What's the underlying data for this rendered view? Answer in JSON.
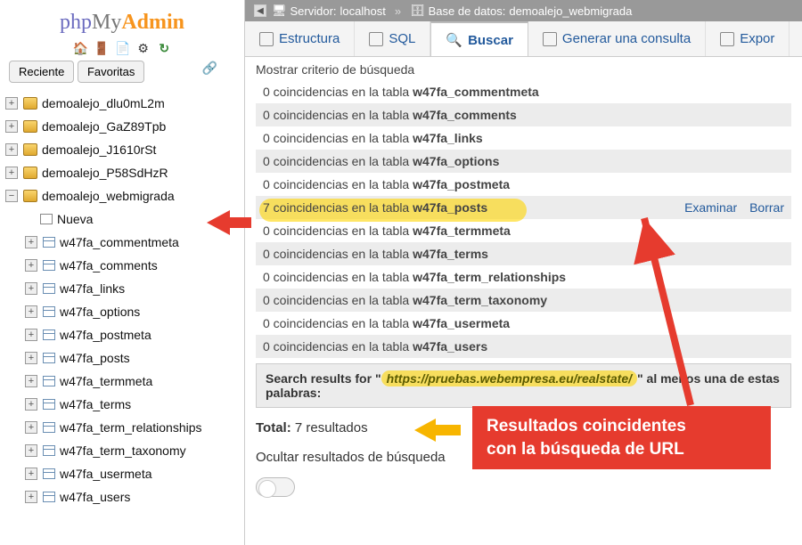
{
  "logo": {
    "php": "php",
    "my": "My",
    "admin": "Admin"
  },
  "sidebar": {
    "recent": "Reciente",
    "fav": "Favoritas",
    "dbs": [
      "demoalejo_dlu0mL2m",
      "demoalejo_GaZ89Tpb",
      "demoalejo_J1610rSt",
      "demoalejo_P58SdHzR",
      "demoalejo_webmigrada"
    ],
    "new_label": "Nueva",
    "tables": [
      "w47fa_commentmeta",
      "w47fa_comments",
      "w47fa_links",
      "w47fa_options",
      "w47fa_postmeta",
      "w47fa_posts",
      "w47fa_termmeta",
      "w47fa_terms",
      "w47fa_term_relationships",
      "w47fa_term_taxonomy",
      "w47fa_usermeta",
      "w47fa_users"
    ]
  },
  "breadcrumb": {
    "server_lbl": "Servidor:",
    "server_val": "localhost",
    "db_lbl": "Base de datos:",
    "db_val": "demoalejo_webmigrada",
    "sep": "»"
  },
  "tabs": {
    "estructura": "Estructura",
    "sql": "SQL",
    "buscar": "Buscar",
    "generar": "Generar una consulta",
    "exportar": "Expor"
  },
  "search": {
    "criteria": "Mostrar criterio de búsqueda",
    "row_prefix0": "0 coincidencias en la tabla ",
    "row_prefix7": "7 coincidencias en la tabla ",
    "examinar": "Examinar",
    "borrar": "Borrar",
    "results": [
      {
        "count": 0,
        "table": "w47fa_commentmeta"
      },
      {
        "count": 0,
        "table": "w47fa_comments"
      },
      {
        "count": 0,
        "table": "w47fa_links"
      },
      {
        "count": 0,
        "table": "w47fa_options"
      },
      {
        "count": 0,
        "table": "w47fa_postmeta"
      },
      {
        "count": 7,
        "table": "w47fa_posts"
      },
      {
        "count": 0,
        "table": "w47fa_termmeta"
      },
      {
        "count": 0,
        "table": "w47fa_terms"
      },
      {
        "count": 0,
        "table": "w47fa_term_relationships"
      },
      {
        "count": 0,
        "table": "w47fa_term_taxonomy"
      },
      {
        "count": 0,
        "table": "w47fa_usermeta"
      },
      {
        "count": 0,
        "table": "w47fa_users"
      }
    ],
    "summary_a": "Search results for \"",
    "summary_url": "https://pruebas.webempresa.eu/realstate/",
    "summary_b": "\" al menos una de estas palabras:",
    "total_lbl": "Total:",
    "total_val": "7 resultados",
    "hide": "Ocultar resultados de búsqueda"
  },
  "annotation": {
    "callout1": "Resultados coincidentes",
    "callout2": "con la búsqueda de URL"
  },
  "icons": {
    "home": "🏠",
    "exit": "🚪",
    "doc": "📄",
    "gear": "⚙",
    "reload": "↻",
    "link": "🔗",
    "server": "🖥",
    "db": "🗄",
    "mag": "🔍"
  }
}
